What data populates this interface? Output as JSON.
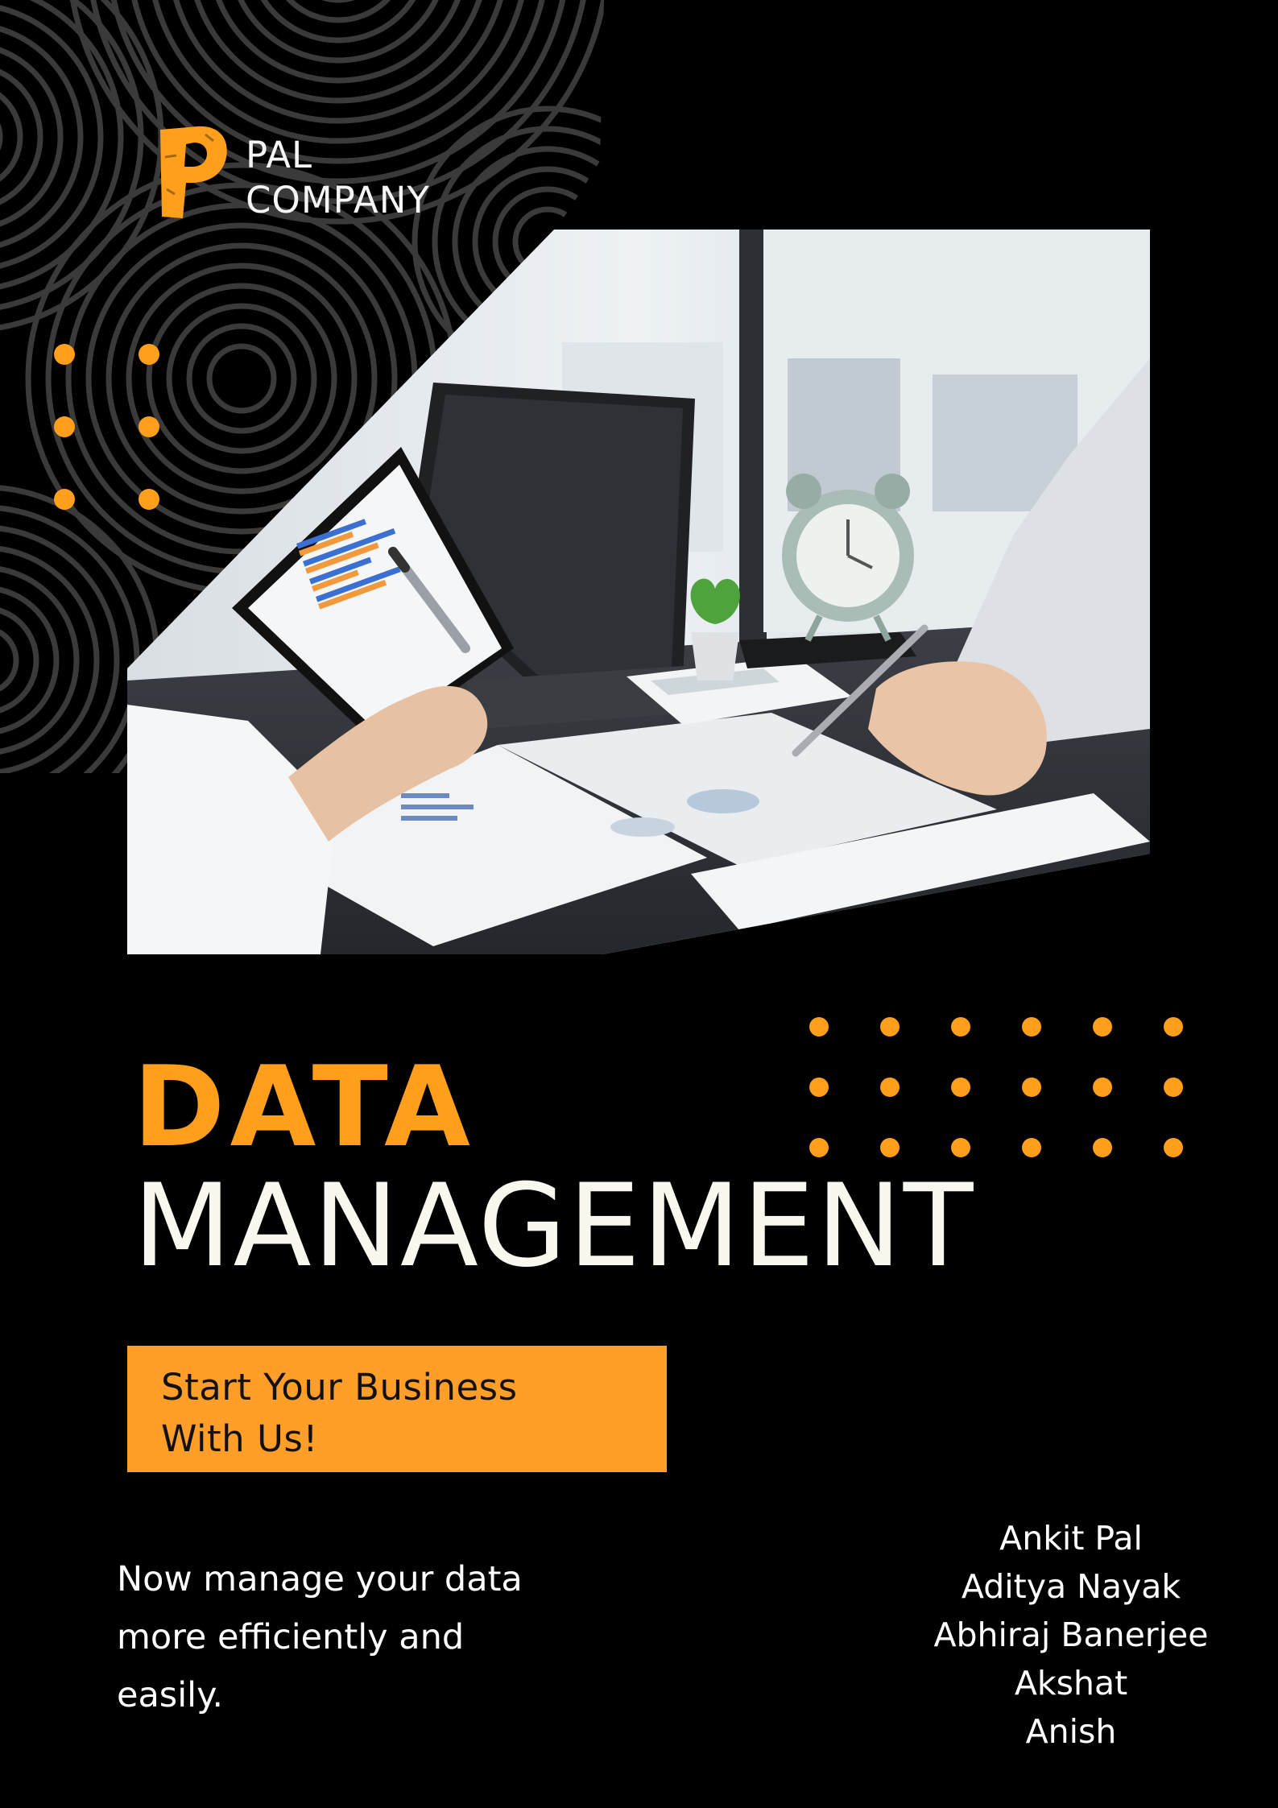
{
  "brand": {
    "name_line1": "PAL",
    "name_line2": "COMPANY",
    "mark_letter": "P"
  },
  "hero_image": {
    "subject": "two people reviewing printed bar charts at a desk with a laptop, calculator, alarm clock and small potted plant"
  },
  "headline": {
    "line1": "DATA",
    "line2": "MANAGEMENT"
  },
  "cta": {
    "line1": "Start Your Business",
    "line2": "With Us!"
  },
  "tagline": {
    "line1": "Now manage your data",
    "line2": "more efficiently and",
    "line3": "easily."
  },
  "members": [
    "Ankit Pal",
    "Aditya Nayak",
    "Abhiraj Banerjee",
    "Akshat",
    "Anish"
  ],
  "colors": {
    "background": "#000000",
    "accent": "#ff9f1c",
    "headline_light": "#f8f8ee",
    "pattern_line": "#3a3a3a"
  }
}
